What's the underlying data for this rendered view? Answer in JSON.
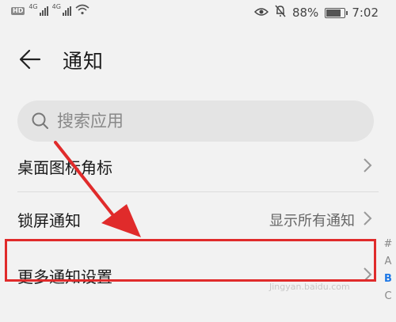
{
  "status_bar": {
    "hd1": "HD",
    "hd2": "HD",
    "net1": "4G",
    "net2": "4G",
    "battery": "88%",
    "battery_level": 0.88,
    "time": "7:02",
    "icons": [
      "eye-icon",
      "mute-bell-icon",
      "battery-icon",
      "wifi-icon",
      "signal-icon"
    ]
  },
  "header": {
    "title": "通知"
  },
  "search": {
    "placeholder": "搜索应用"
  },
  "settings": [
    {
      "label": "桌面图标角标",
      "value": ""
    },
    {
      "label": "锁屏通知",
      "value": "显示所有通知"
    },
    {
      "label": "更多通知设置",
      "value": ""
    }
  ],
  "index_bar": [
    "#",
    "A",
    "B",
    "C"
  ],
  "index_active": "B",
  "watermark": "Jingyan.baidu.com",
  "colors": {
    "highlight": "#e02b2b",
    "arrow": "#e02b2b",
    "index_active": "#1e78e6"
  }
}
